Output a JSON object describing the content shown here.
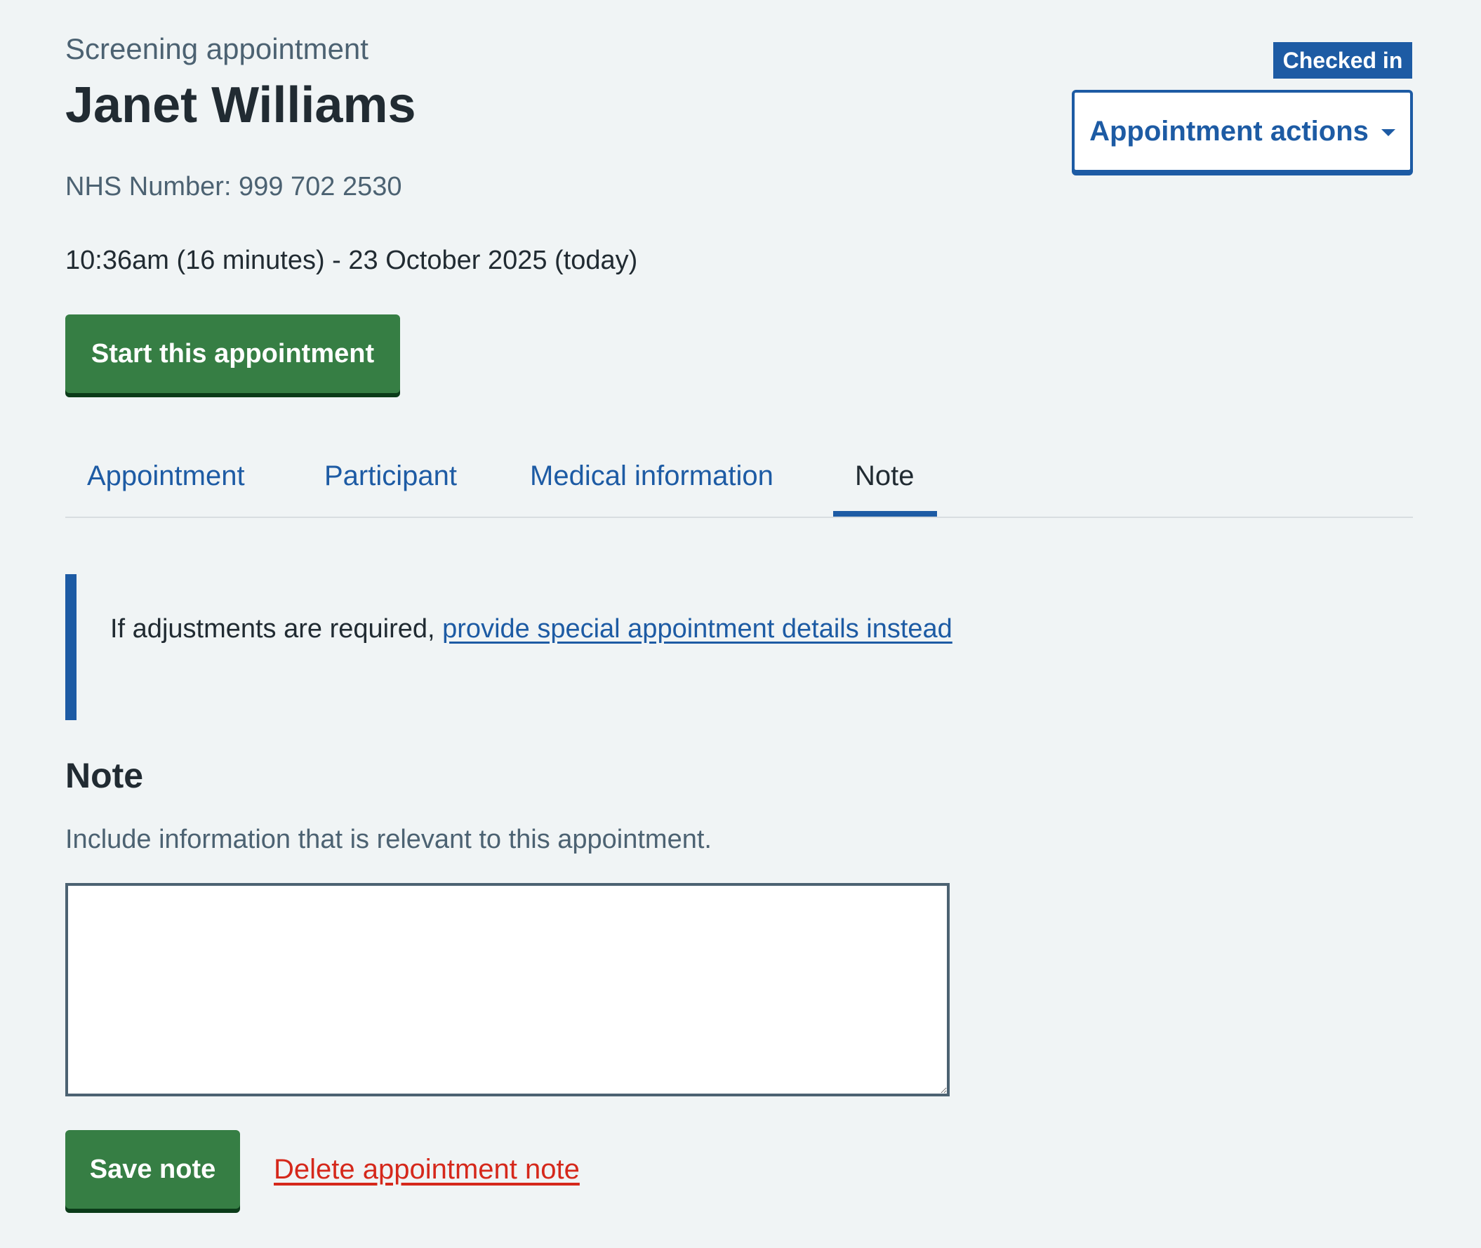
{
  "header": {
    "caption": "Screening appointment",
    "participant_name": "Janet Williams",
    "nhs_number": "NHS Number: 999 702 2530",
    "datetime": "10:36am (16 minutes) - 23 October 2025 (today)",
    "status_tag": "Checked in",
    "actions_button_label": "Appointment actions"
  },
  "start_button_label": "Start this appointment",
  "tabs": [
    {
      "label": "Appointment",
      "active": false
    },
    {
      "label": "Participant",
      "active": false
    },
    {
      "label": "Medical information",
      "active": false
    },
    {
      "label": "Note",
      "active": true
    }
  ],
  "inset": {
    "text": "If adjustments are required, ",
    "link_text": "provide special appointment details instead"
  },
  "note": {
    "heading": "Note",
    "hint": "Include information that is relevant to this appointment.",
    "value": "",
    "save_label": "Save note",
    "delete_label": "Delete appointment note"
  },
  "colors": {
    "background": "#f0f4f5",
    "primary_blue": "#1d5ba4",
    "green_button": "#367e44",
    "delete_red": "#d5281b",
    "text": "#212b32",
    "secondary_text": "#4c6272"
  }
}
